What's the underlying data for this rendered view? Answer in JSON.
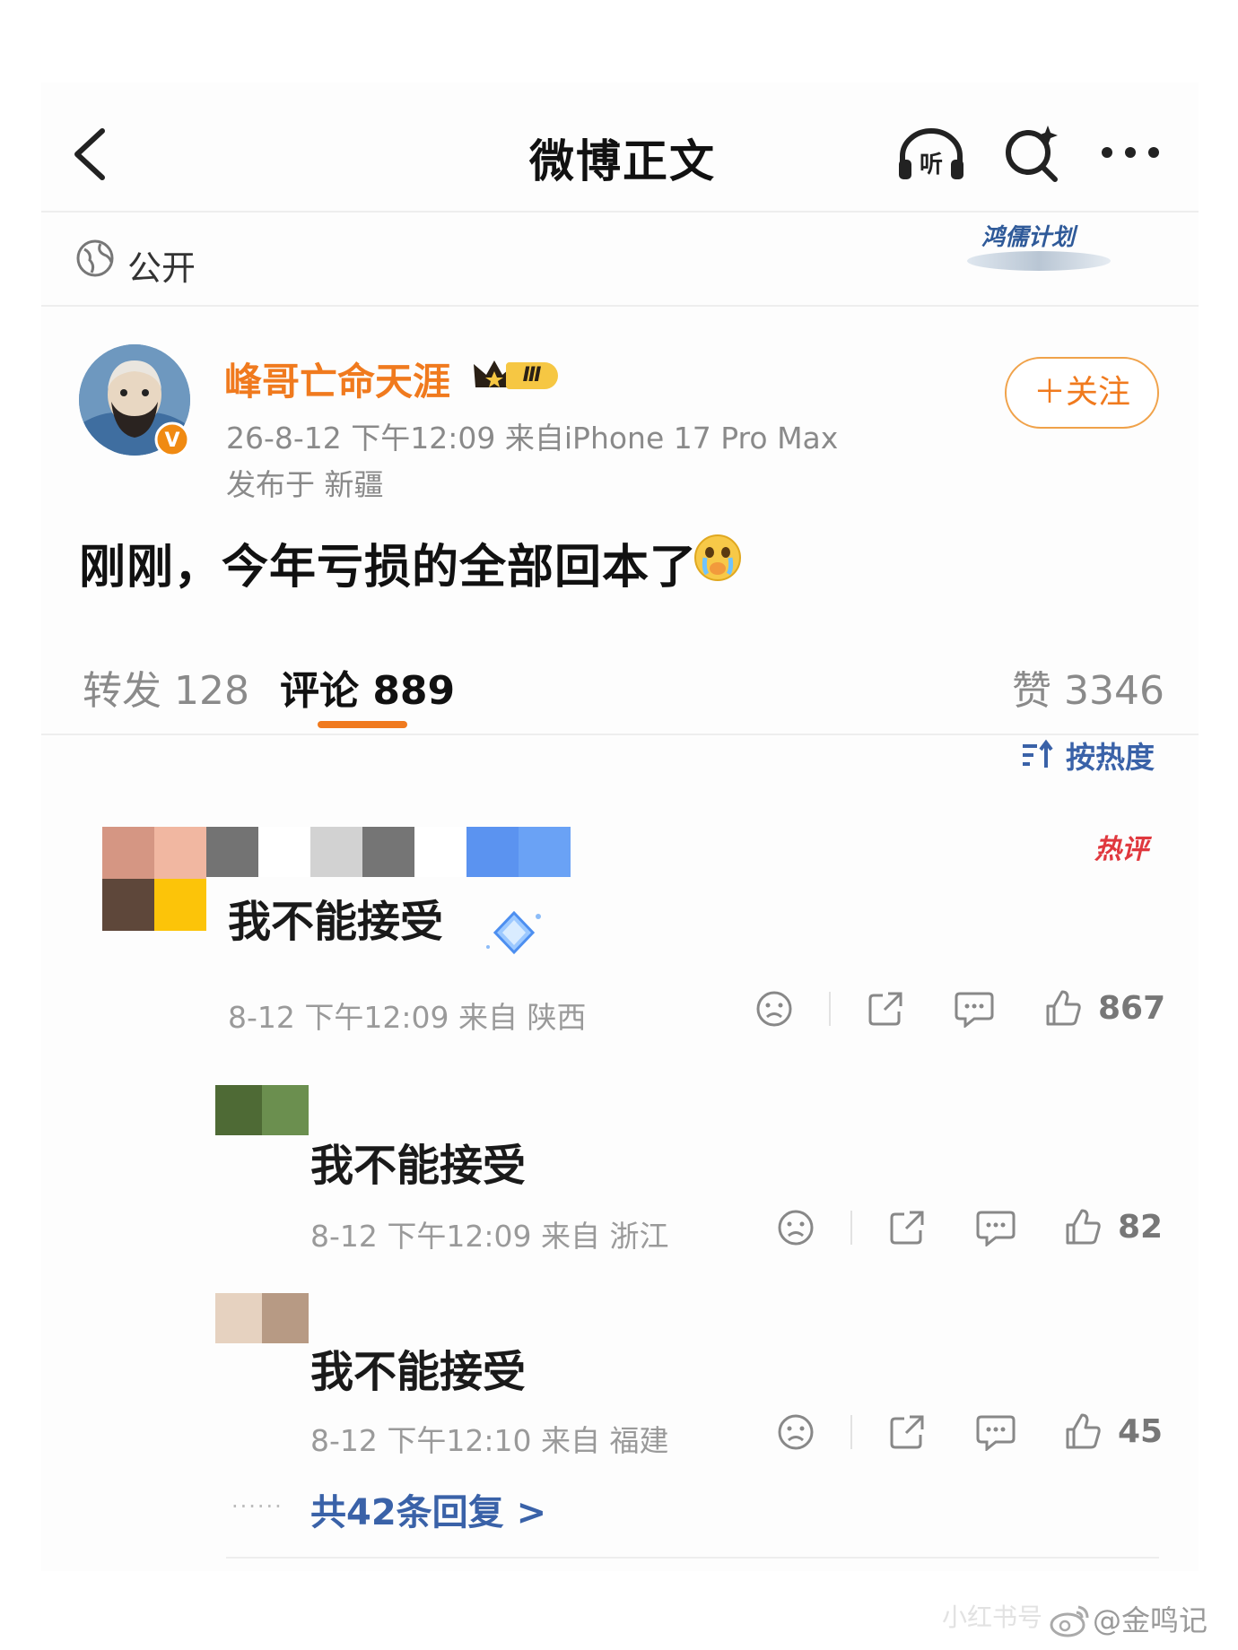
{
  "header": {
    "title": "微博正文"
  },
  "post_meta": {
    "visibility": "公开",
    "campaign_badge": "鸿儒计划"
  },
  "author": {
    "name": "峰哥亡命天涯",
    "level_badge": "Ⅲ",
    "time_source": "26-8-12 下午12:09  来自iPhone 17 Pro Max",
    "location": "发布于 新疆",
    "follow_label": "＋关注"
  },
  "post": {
    "text": "刚刚，今年亏损的全部回本了"
  },
  "tabs": {
    "reposts": "转发 128",
    "comments": "评论 889",
    "likes": "赞 3346"
  },
  "sort": {
    "label": "按热度"
  },
  "hot_badge": "热评",
  "comments": [
    {
      "text": "我不能接受",
      "meta": "8-12 下午12:09 来自 陕西",
      "likes": "867"
    },
    {
      "text": "我不能接受",
      "meta": "8-12 下午12:09 来自 浙江",
      "likes": "82"
    },
    {
      "text": "我不能接受",
      "meta": "8-12 下午12:10 来自 福建",
      "likes": "45"
    }
  ],
  "replies_link": "共42条回复 >",
  "watermark": {
    "handle": "@金鸣记",
    "source": "小红书号"
  },
  "colors": {
    "accent_orange": "#f07a1e",
    "link_blue": "#3a62a8",
    "follow_border": "#f0a24a"
  }
}
